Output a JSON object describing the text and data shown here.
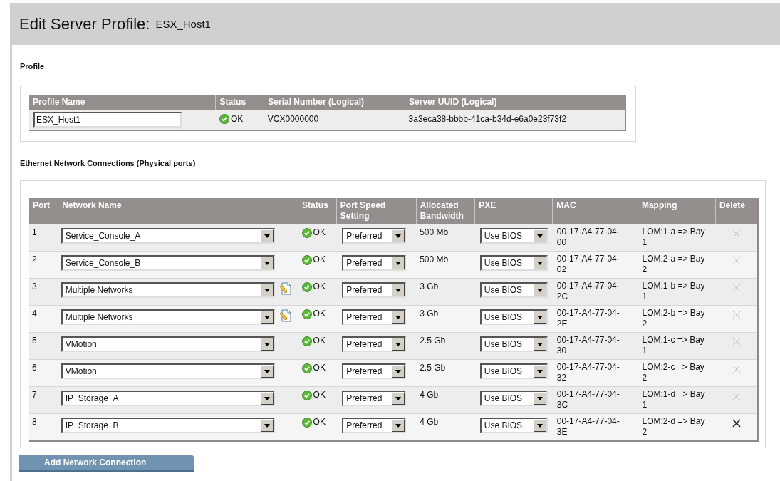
{
  "page_title": {
    "label": "Edit Server Profile:",
    "value": "ESX_Host1"
  },
  "profile": {
    "heading": "Profile",
    "columns": [
      "Profile Name",
      "Status",
      "Serial Number (Logical)",
      "Server UUID (Logical)"
    ],
    "row": {
      "profile_name": "ESX_Host1",
      "status": "OK",
      "serial": "VCX0000000",
      "uuid": "3a3eca38-bbbb-41ca-b34d-e6a0e23f73f2"
    }
  },
  "ethernet": {
    "heading": "Ethernet Network Connections (Physical ports)",
    "columns": [
      "Port",
      "Network Name",
      "Status",
      "Port Speed Setting",
      "Allocated Bandwidth",
      "PXE",
      "MAC",
      "Mapping",
      "Delete"
    ],
    "rows": [
      {
        "port": "1",
        "network": "Service_Console_A",
        "editable": false,
        "status": "OK",
        "speed": "Preferred",
        "bandwidth": "500 Mb",
        "pxe": "Use BIOS",
        "mac": "00-17-A4-77-04-00",
        "mapping": "LOM:1-a => Bay 1",
        "delete_enabled": false
      },
      {
        "port": "2",
        "network": "Service_Console_B",
        "editable": false,
        "status": "OK",
        "speed": "Preferred",
        "bandwidth": "500 Mb",
        "pxe": "Use BIOS",
        "mac": "00-17-A4-77-04-02",
        "mapping": "LOM:2-a => Bay 2",
        "delete_enabled": false
      },
      {
        "port": "3",
        "network": "Multiple Networks",
        "editable": true,
        "status": "OK",
        "speed": "Preferred",
        "bandwidth": "3 Gb",
        "pxe": "Use BIOS",
        "mac": "00-17-A4-77-04-2C",
        "mapping": "LOM:1-b => Bay 1",
        "delete_enabled": false
      },
      {
        "port": "4",
        "network": "Multiple Networks",
        "editable": true,
        "status": "OK",
        "speed": "Preferred",
        "bandwidth": "3 Gb",
        "pxe": "Use BIOS",
        "mac": "00-17-A4-77-04-2E",
        "mapping": "LOM:2-b => Bay 2",
        "delete_enabled": false
      },
      {
        "port": "5",
        "network": "VMotion",
        "editable": false,
        "status": "OK",
        "speed": "Preferred",
        "bandwidth": "2.5 Gb",
        "pxe": "Use BIOS",
        "mac": "00-17-A4-77-04-30",
        "mapping": "LOM:1-c => Bay 1",
        "delete_enabled": false
      },
      {
        "port": "6",
        "network": "VMotion",
        "editable": false,
        "status": "OK",
        "speed": "Preferred",
        "bandwidth": "2.5 Gb",
        "pxe": "Use BIOS",
        "mac": "00-17-A4-77-04-32",
        "mapping": "LOM:2-c => Bay 2",
        "delete_enabled": false
      },
      {
        "port": "7",
        "network": "IP_Storage_A",
        "editable": false,
        "status": "OK",
        "speed": "Preferred",
        "bandwidth": "4 Gb",
        "pxe": "Use BIOS",
        "mac": "00-17-A4-77-04-3C",
        "mapping": "LOM:1-d => Bay 1",
        "delete_enabled": false
      },
      {
        "port": "8",
        "network": "IP_Storage_B",
        "editable": false,
        "status": "OK",
        "speed": "Preferred",
        "bandwidth": "4 Gb",
        "pxe": "Use BIOS",
        "mac": "00-17-A4-77-04-3E",
        "mapping": "LOM:2-d => Bay 2",
        "delete_enabled": true
      }
    ],
    "add_button": "Add Network Connection"
  }
}
